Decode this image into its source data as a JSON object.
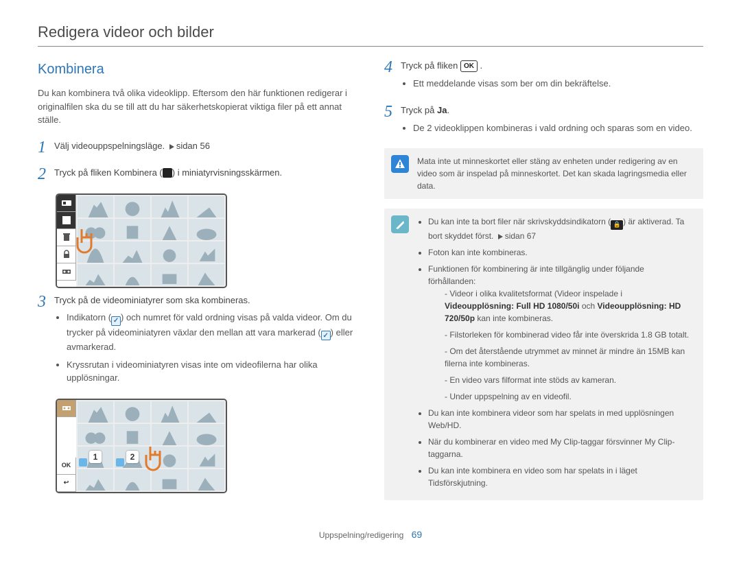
{
  "pageTitle": "Redigera videor och bilder",
  "sectionHeading": "Kombinera",
  "intro": "Du kan kombinera två olika videoklipp. Eftersom den här funktionen redigerar i originalfilen ska du se till att du har säkerhetskopierat viktiga filer på ett annat ställe.",
  "steps": {
    "1": {
      "text": "Välj videouppspelningsläge.",
      "page_ref": "sidan 56"
    },
    "2": {
      "text_before": "Tryck på fliken Kombinera (",
      "text_after": ") i miniatyrvisningsskärmen."
    },
    "3": {
      "text": "Tryck på de videominiatyrer som ska kombineras.",
      "bullet1_a": "Indikatorn (",
      "bullet1_b": ") och numret för vald ordning visas på valda videor. Om du trycker på videominiatyren växlar den mellan att vara markerad (",
      "bullet1_c": ") eller avmarkerad.",
      "bullet2": "Kryssrutan i videominiatyren visas inte om videofilerna har olika upplösningar."
    },
    "4": {
      "text_before": "Tryck på fliken ",
      "ok_label": "OK",
      "text_after": " .",
      "bullet1": "Ett meddelande visas som ber om din bekräftelse."
    },
    "5": {
      "text_before": "Tryck på ",
      "bold": "Ja",
      "text_after": ".",
      "bullet1": "De 2 videoklippen kombineras i vald ordning och sparas som en video."
    }
  },
  "warning": {
    "text": "Mata inte ut minneskortet eller stäng av enheten under redigering av en video som är inspelad på minneskortet. Det kan skada lagringsmedia eller data."
  },
  "notes": {
    "b1_a": "Du kan inte ta bort filer när skrivskyddsindikatorn (",
    "b1_b": ") är aktiverad. Ta bort skyddet först.",
    "b1_ref": "sidan 67",
    "b2": "Foton kan inte kombineras.",
    "b3": "Funktionen för kombinering är inte tillgänglig under följande förhållanden:",
    "d1_a": "Videor i olika kvalitetsformat (Videor inspelade i ",
    "d1_bold1": "Videoupplösning: Full HD 1080/50i",
    "d1_mid": " och ",
    "d1_bold2": "Videoupplösning: HD 720/50p",
    "d1_b": " kan inte kombineras.",
    "d2": "Filstorleken för kombinerad video får inte överskrida 1.8 GB totalt.",
    "d3": "Om det återstående utrymmet av minnet är mindre än 15MB kan filerna inte kombineras.",
    "d4": "En video vars filformat inte stöds av kameran.",
    "d5": "Under uppspelning av en videofil.",
    "b4": "Du kan inte kombinera videor som har spelats in med upplösningen Web/HD.",
    "b5": "När du kombinerar en video med My Clip-taggar försvinner My Clip-taggarna.",
    "b6": "Du kan inte kombinera en video som har spelats in i läget Tidsförskjutning."
  },
  "screen2": {
    "ok": "OK",
    "back": "↩"
  },
  "footer": {
    "section": "Uppspelning/redigering",
    "page": "69"
  }
}
